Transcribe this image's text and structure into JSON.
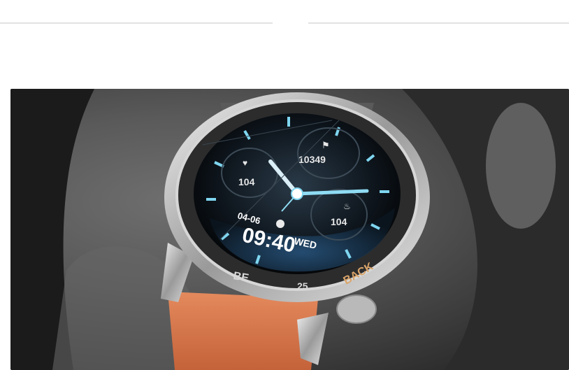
{
  "watch": {
    "date": "04-06",
    "time": "09:40",
    "weekday": "WED",
    "steps": "10349",
    "heart_rate": "104",
    "calories": "104",
    "bezel_left": "BE",
    "bezel_bottom": "25",
    "bezel_back": "BACK"
  },
  "colors": {
    "accent": "#7fd6f0",
    "strap": "#e07a4e",
    "case": "#c9c9c9"
  }
}
